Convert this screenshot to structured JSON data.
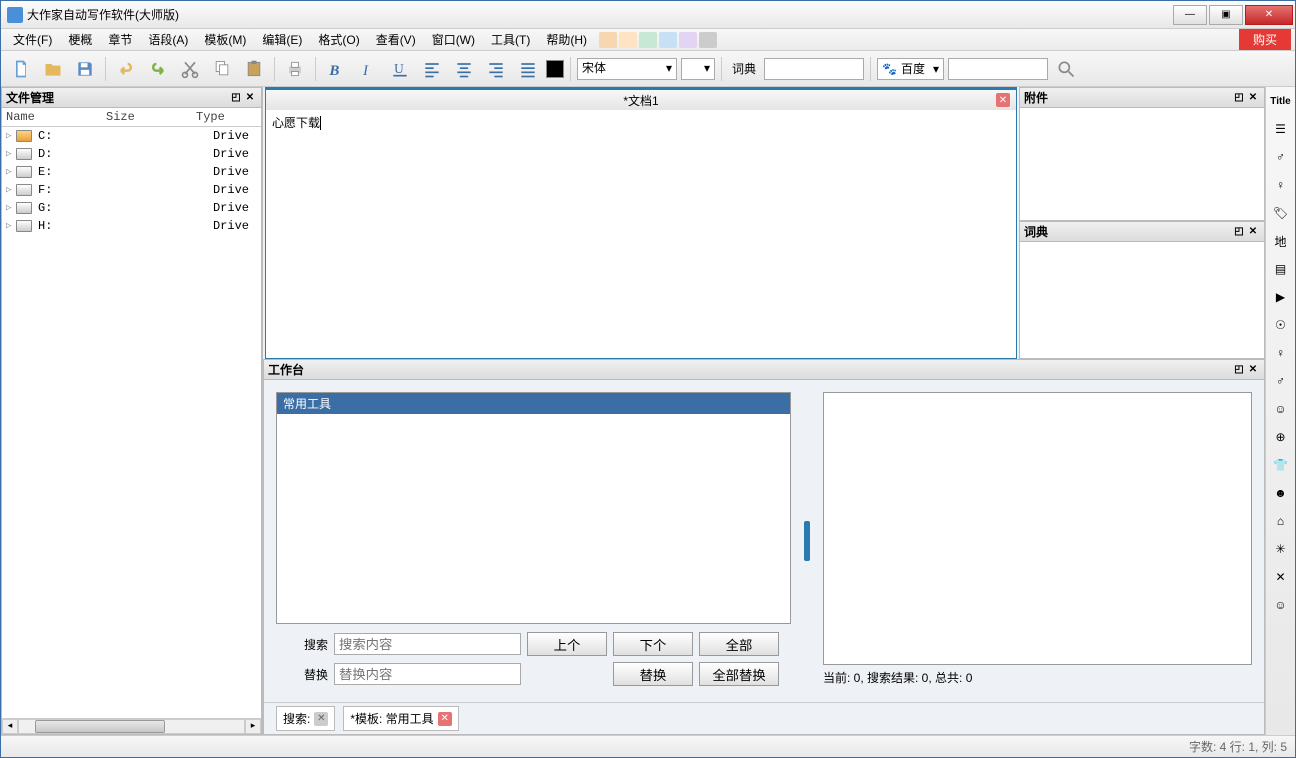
{
  "window": {
    "title": "大作家自动写作软件(大师版)"
  },
  "menu": {
    "file": "文件(F)",
    "outline": "梗概",
    "chapter": "章节",
    "phrase": "语段(A)",
    "template": "模板(M)",
    "edit": "编辑(E)",
    "format": "格式(O)",
    "view": "查看(V)",
    "window": "窗口(W)",
    "tool": "工具(T)",
    "help": "帮助(H)",
    "buy": "购买"
  },
  "toolbar": {
    "font": "宋体",
    "dict_label": "词典",
    "search_engine": "百度"
  },
  "swatches": [
    "#f6d7b0",
    "#ffe4c4",
    "#c7e8d5",
    "#c7e0f4",
    "#e3d4f4",
    "#cccccc"
  ],
  "file_panel": {
    "title": "文件管理",
    "cols": {
      "name": "Name",
      "size": "Size",
      "type": "Type"
    },
    "drives": [
      {
        "name": "C:",
        "type": "Drive",
        "c": true
      },
      {
        "name": "D:",
        "type": "Drive"
      },
      {
        "name": "E:",
        "type": "Drive"
      },
      {
        "name": "F:",
        "type": "Drive"
      },
      {
        "name": "G:",
        "type": "Drive"
      },
      {
        "name": "H:",
        "type": "Drive"
      }
    ]
  },
  "editor": {
    "tab": "*文档1",
    "content": "心愿下载"
  },
  "right": {
    "attach": "附件",
    "dict": "词典"
  },
  "side": {
    "title": "Title"
  },
  "workspace": {
    "title": "工作台",
    "tab": "常用工具",
    "search_label": "搜索",
    "replace_label": "替换",
    "search_ph": "搜索内容",
    "replace_ph": "替换内容",
    "prev": "上个",
    "next": "下个",
    "all": "全部",
    "do_replace": "替换",
    "replace_all": "全部替换",
    "status": "当前: 0, 搜索结果: 0, 总共: 0"
  },
  "bottom": {
    "search_label": "搜索:",
    "template_tab": "*模板: 常用工具"
  },
  "status": "字数: 4 行: 1, 列: 5"
}
